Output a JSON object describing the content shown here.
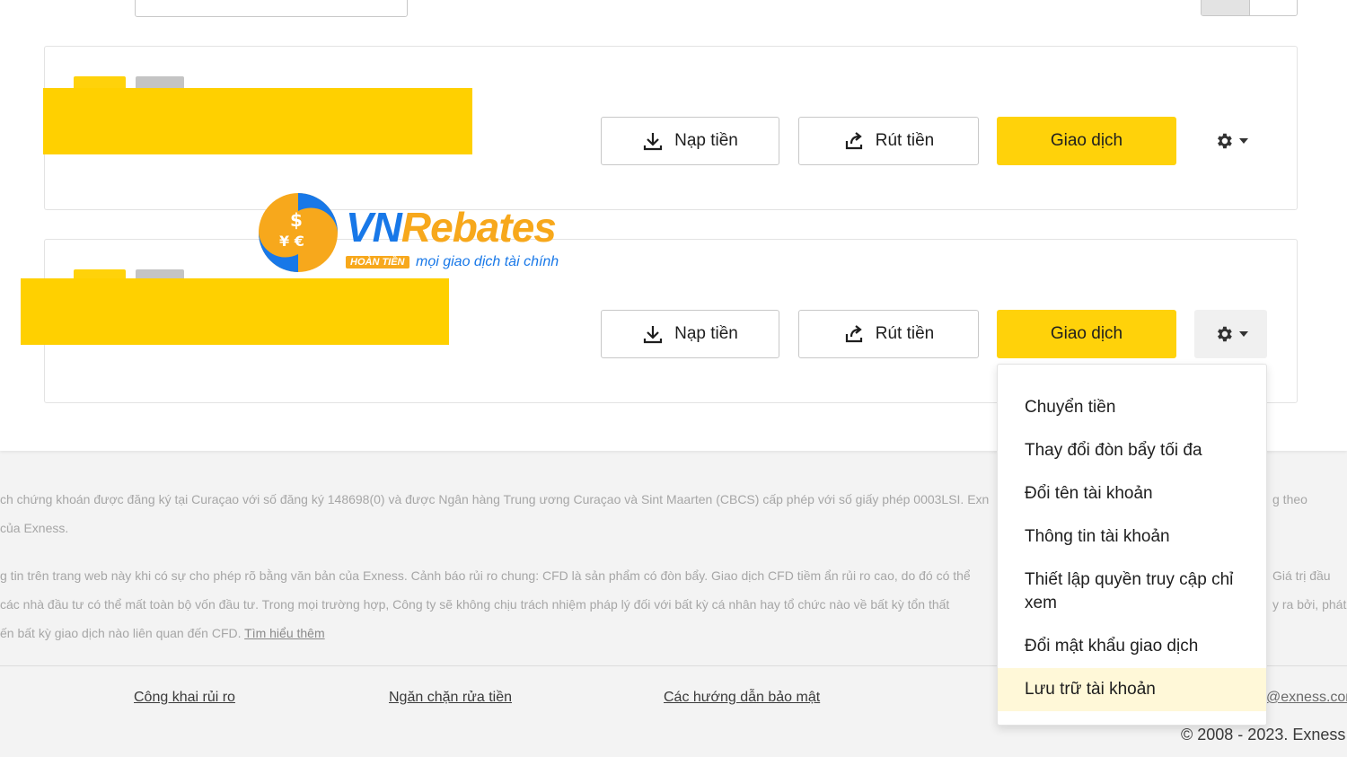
{
  "accounts": [
    {
      "actions": {
        "deposit": "Nạp tiền",
        "withdraw": "Rút tiền",
        "trade": "Giao dịch"
      }
    },
    {
      "actions": {
        "deposit": "Nạp tiền",
        "withdraw": "Rút tiền",
        "trade": "Giao dịch"
      }
    }
  ],
  "settings_menu": {
    "items": [
      "Chuyển tiền",
      "Thay đổi đòn bẩy tối đa",
      "Đổi tên tài khoản",
      "Thông tin tài khoản",
      "Thiết lập quyền truy cập chỉ xem",
      "Đổi mật khẩu giao dịch",
      "Lưu trữ tài khoản"
    ],
    "highlighted_index": 6
  },
  "watermark": {
    "brand_vn": "VN",
    "brand_rebates": "Rebates",
    "badge": "HOÀN TIỀN",
    "tagline": "mọi giao dịch tài chính"
  },
  "footer": {
    "line1": "ch chứng khoán được đăng ký tại Curaçao với số đăng ký 148698(0) và được Ngân hàng Trung ương Curaçao và Sint Maarten (CBCS) cấp phép với số giấy phép 0003LSI. Exn",
    "line1_right": "g theo",
    "line2": "của Exness.",
    "line3": "g tin trên trang web này khi có sự cho phép rõ bằng văn bản của Exness. Cảnh báo rủi ro chung: CFD là sản phẩm có đòn bẩy. Giao dịch CFD tiềm ẩn rủi ro cao, do đó có thể",
    "line3_right": "Giá trị đầu",
    "line4": "các nhà đầu tư có thể mất toàn bộ vốn đầu tư. Trong mọi trường hợp, Công ty sẽ không chịu trách nhiệm pháp lý đối với bất kỳ cá nhân hay tổ chức nào về bất kỳ tổn thất",
    "line4_right": "y ra bởi, phát",
    "line5": "ến bất kỳ giao dịch nào liên quan đến CFD.",
    "learn_more": "Tìm hiểu thêm",
    "links": [
      "Công khai rủi ro",
      "Ngăn chặn rửa tiền",
      "Các hướng dẫn bảo mật"
    ],
    "email": "@exness.com",
    "copyright": "© 2008 - 2023. Exness"
  },
  "colors": {
    "accent": "#ffd20a",
    "menu_highlight": "#fff8d8"
  }
}
